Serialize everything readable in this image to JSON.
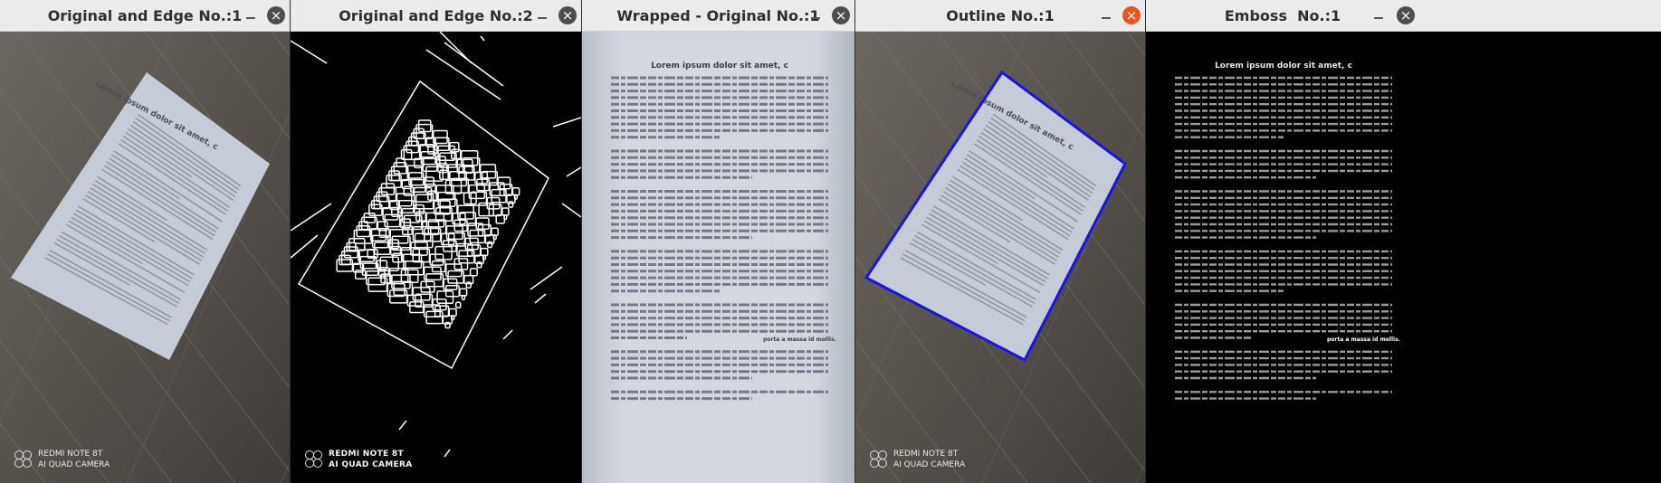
{
  "windows": [
    {
      "title": "Original and Edge No.:1",
      "close_active": false
    },
    {
      "title": "Original and Edge No.:2",
      "close_active": false
    },
    {
      "title": "Wrapped - Original No.:1",
      "close_active": false
    },
    {
      "title": "Outline No.:1",
      "close_active": true
    },
    {
      "title": "Emboss  No.:1",
      "close_active": false
    }
  ],
  "controls": {
    "minimize_glyph": "–",
    "close_glyph": "×"
  },
  "watermark": {
    "line1": "REDMI NOTE 8T",
    "line2": "AI QUAD CAMERA"
  },
  "document": {
    "heading": "Lorem ipsum dolor sit amet, c",
    "bold_phrase": "porta a massa id mollis."
  },
  "colors": {
    "outline": "#1a14e6",
    "close_active": "#e95420",
    "titlebar": "#ebebeb"
  }
}
